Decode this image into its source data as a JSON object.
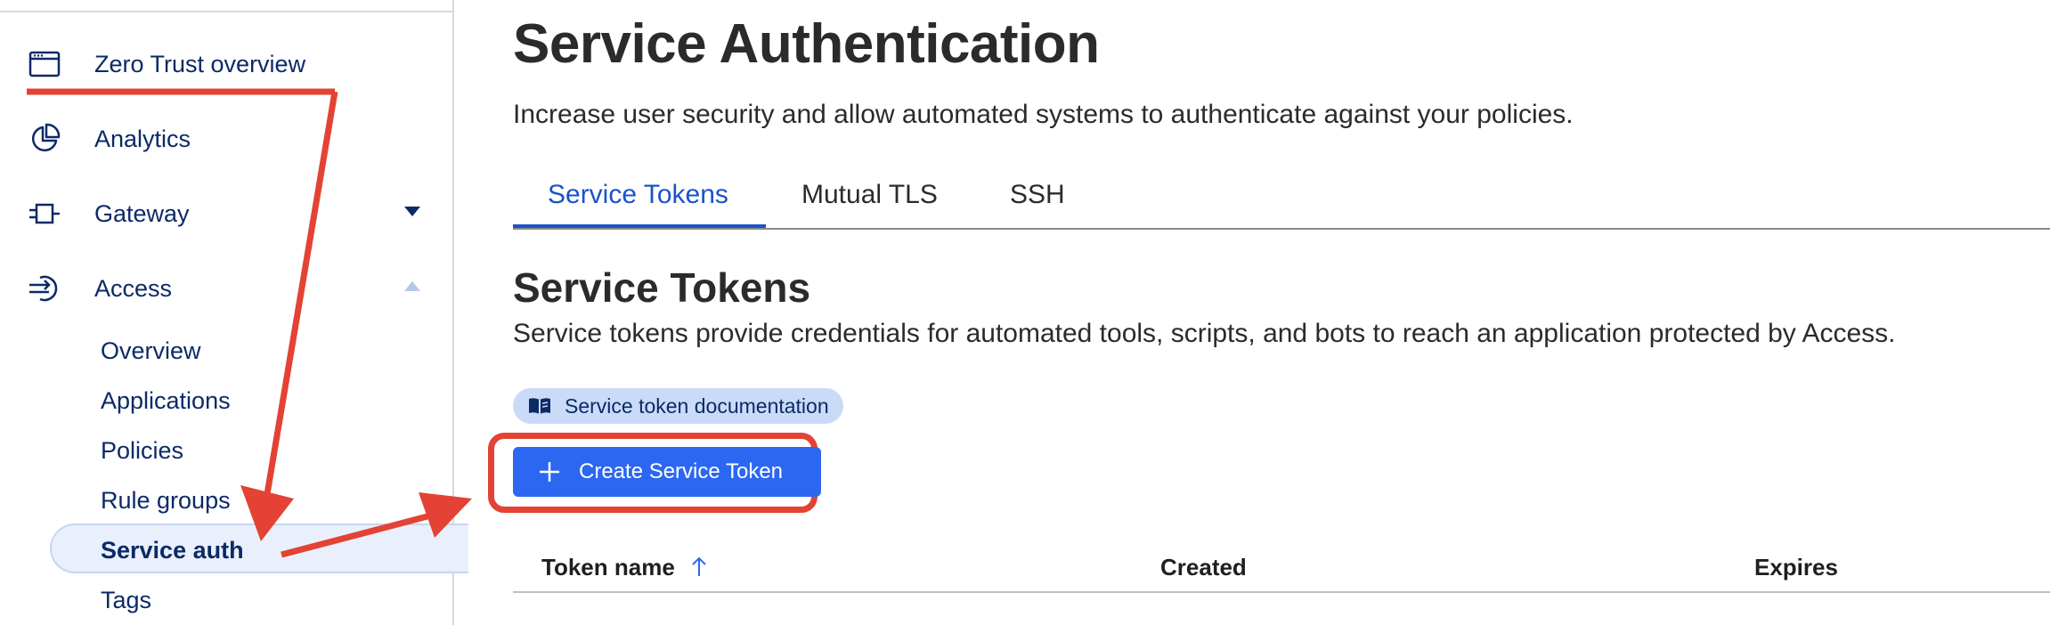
{
  "sidebar": {
    "items": [
      {
        "label": "Zero Trust overview",
        "icon": "browser-window-icon"
      },
      {
        "label": "Analytics",
        "icon": "pie-chart-icon"
      },
      {
        "label": "Gateway",
        "icon": "gateway-icon",
        "caret": "down"
      },
      {
        "label": "Access",
        "icon": "access-icon",
        "caret": "up"
      }
    ],
    "access_subitems": [
      "Overview",
      "Applications",
      "Policies",
      "Rule groups",
      "Service auth",
      "Tags"
    ],
    "active_subitem": "Service auth"
  },
  "main": {
    "title": "Service Authentication",
    "subtitle": "Increase user security and allow automated systems to authenticate against your policies.",
    "tabs": [
      "Service Tokens",
      "Mutual TLS",
      "SSH"
    ],
    "active_tab": "Service Tokens",
    "section_title": "Service Tokens",
    "section_description": "Service tokens provide credentials for automated tools, scripts, and bots to reach an application protected by Access.",
    "doc_link": "Service token documentation",
    "create_button": "Create Service Token",
    "table_headers": [
      "Token name",
      "Created",
      "Expires"
    ]
  },
  "colors": {
    "accent": "#2c67f2",
    "annotation_red": "#e34234",
    "nav_text": "#0b2a66"
  }
}
